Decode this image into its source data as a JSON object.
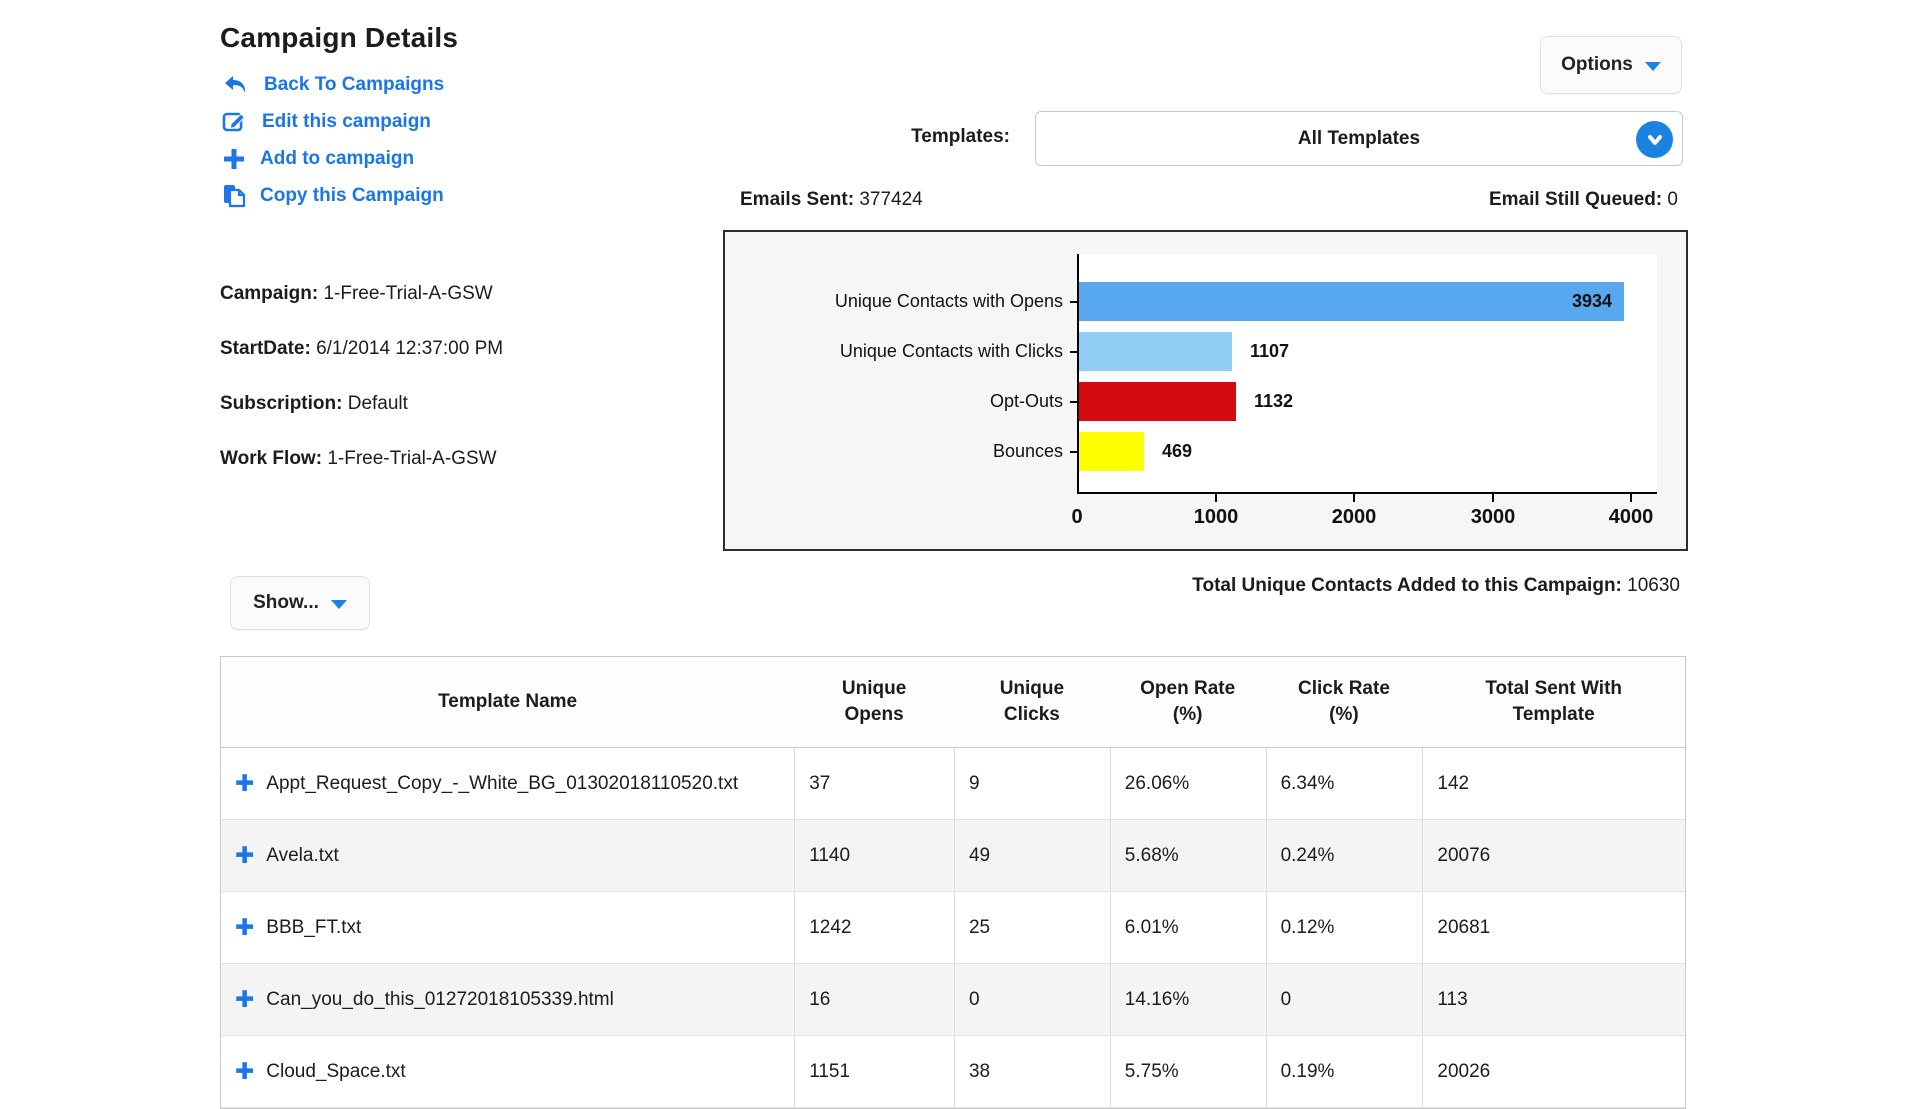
{
  "page": {
    "title": "Campaign Details"
  },
  "actions": [
    {
      "label": "Back To Campaigns",
      "icon": "back-arrow-icon"
    },
    {
      "label": "Edit this campaign",
      "icon": "edit-icon"
    },
    {
      "label": "Add to campaign",
      "icon": "plus-icon"
    },
    {
      "label": "Copy this Campaign",
      "icon": "copy-icon"
    }
  ],
  "campaign_info": [
    {
      "label": "Campaign:",
      "value": "1-Free-Trial-A-GSW"
    },
    {
      "label": "StartDate:",
      "value": "6/1/2014 12:37:00 PM"
    },
    {
      "label": "Subscription:",
      "value": "Default"
    },
    {
      "label": "Work Flow:",
      "value": "1-Free-Trial-A-GSW"
    }
  ],
  "toolbar": {
    "options_label": "Options",
    "show_label": "Show..."
  },
  "templates_filter": {
    "label": "Templates:",
    "selected": "All Templates"
  },
  "stats": {
    "emails_sent_label": "Emails Sent:",
    "emails_sent_value": "377424",
    "queued_label": "Email Still Queued:",
    "queued_value": "0",
    "total_contacts_label": "Total Unique Contacts Added to this Campaign:",
    "total_contacts_value": "10630"
  },
  "chart_data": {
    "type": "bar",
    "orientation": "horizontal",
    "categories": [
      "Unique Contacts with Opens",
      "Unique Contacts with Clicks",
      "Opt-Outs",
      "Bounces"
    ],
    "values": [
      3934,
      1107,
      1132,
      469
    ],
    "colors": [
      "#58a8ef",
      "#8fcdf4",
      "#d40a10",
      "#ffff00"
    ],
    "value_label_inside": [
      true,
      false,
      false,
      false
    ],
    "xticks": [
      0,
      1000,
      2000,
      3000,
      4000
    ],
    "xlim": [
      0,
      4000
    ],
    "grid": false,
    "legend": false,
    "title": ""
  },
  "table": {
    "columns": [
      "Template Name",
      "Unique\nOpens",
      "Unique\nClicks",
      "Open Rate\n(%)",
      "Click Rate\n(%)",
      "Total Sent With\nTemplate"
    ],
    "rows": [
      [
        "Appt_Request_Copy_-_White_BG_01302018110520.txt",
        "37",
        "9",
        "26.06%",
        "6.34%",
        "142"
      ],
      [
        "Avela.txt",
        "1140",
        "49",
        "5.68%",
        "0.24%",
        "20076"
      ],
      [
        "BBB_FT.txt",
        "1242",
        "25",
        "6.01%",
        "0.12%",
        "20681"
      ],
      [
        "Can_you_do_this_01272018105339.html",
        "16",
        "0",
        "14.16%",
        "0",
        "113"
      ],
      [
        "Cloud_Space.txt",
        "1151",
        "38",
        "5.75%",
        "0.19%",
        "20026"
      ]
    ],
    "row_icon": "plus-icon"
  }
}
